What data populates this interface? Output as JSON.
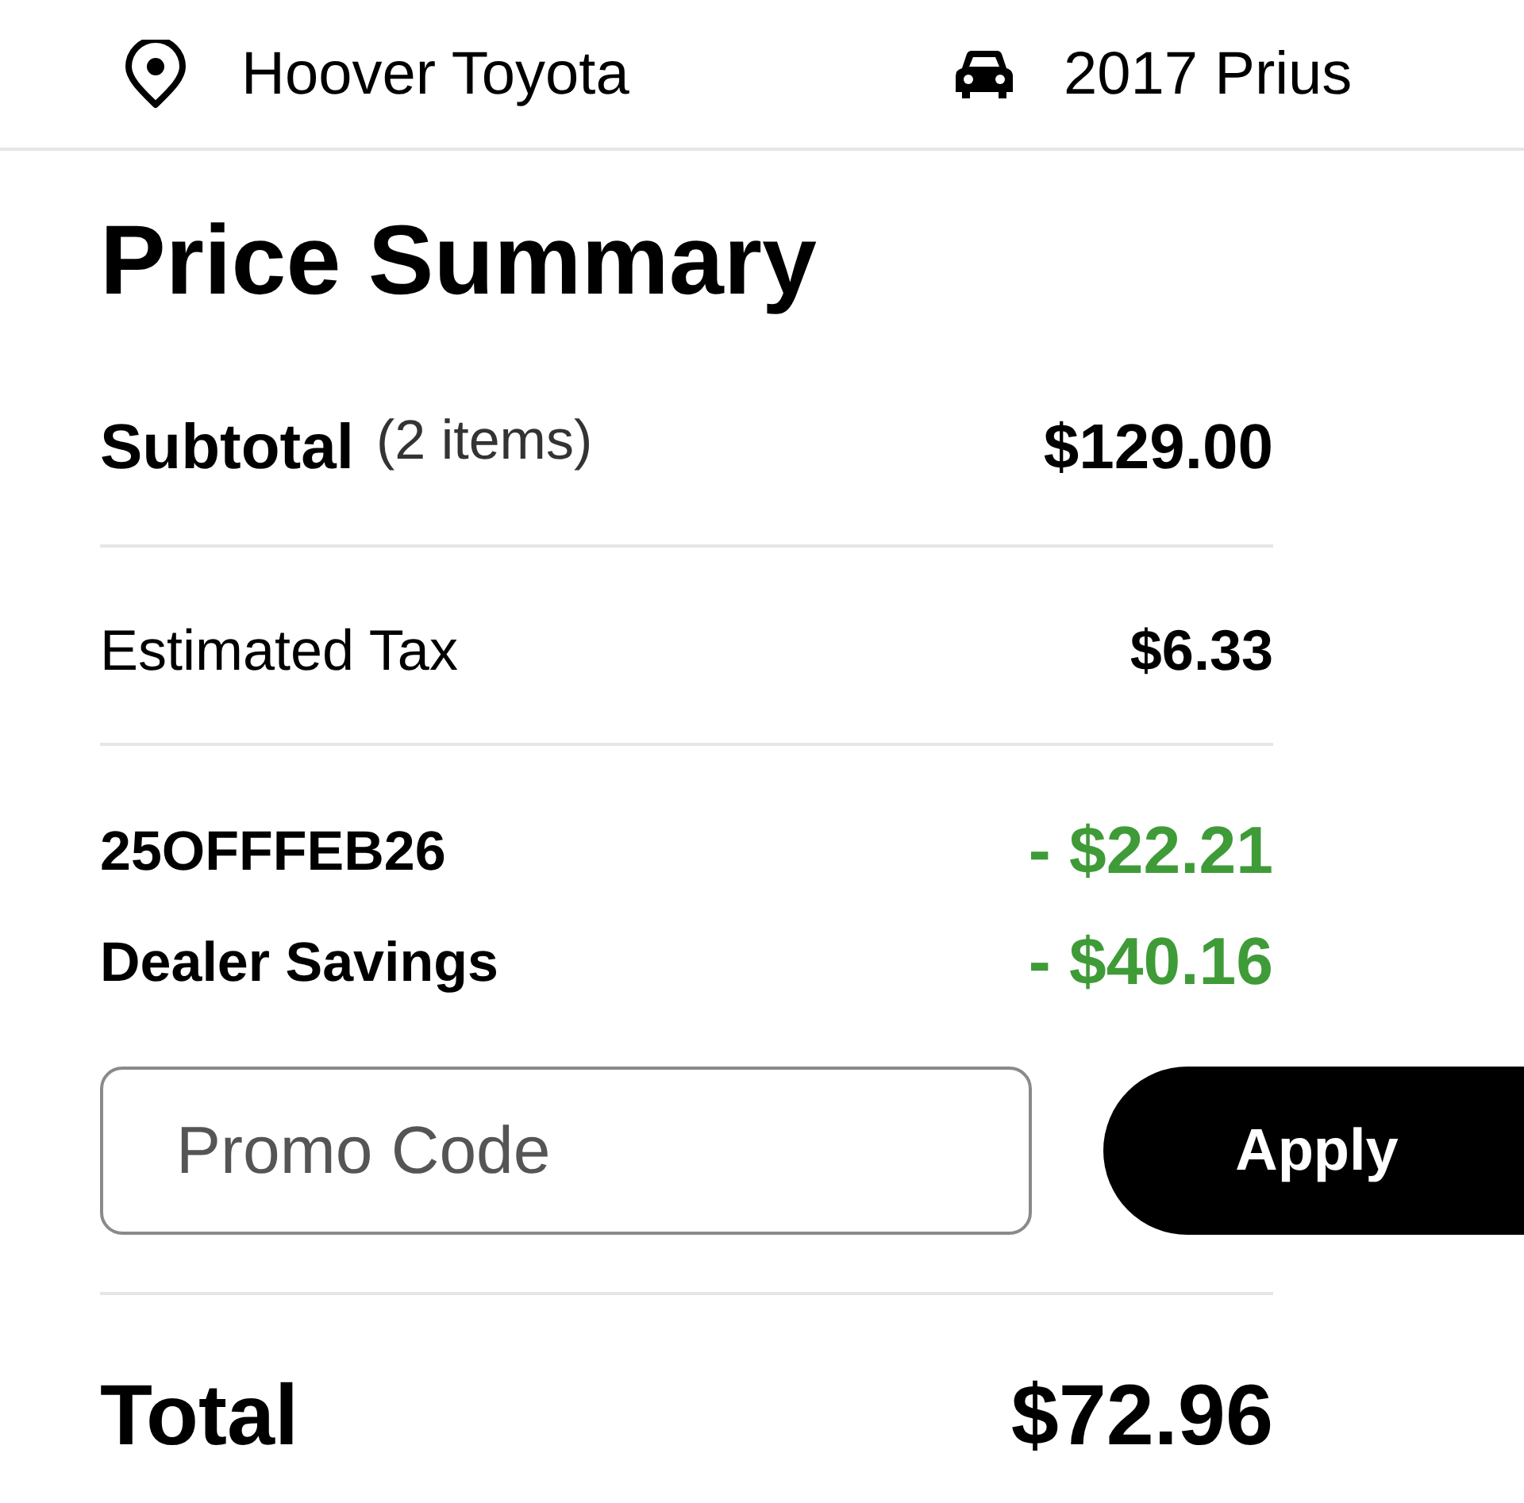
{
  "header": {
    "dealer": "Hoover Toyota",
    "vehicle": "2017 Prius"
  },
  "title": "Price Summary",
  "subtotal": {
    "label": "Subtotal",
    "count": "(2 items)",
    "amount": "$129.00"
  },
  "tax": {
    "label": "Estimated Tax",
    "amount": "$6.33"
  },
  "discounts": [
    {
      "label": "25OFFFEB26",
      "amount": "- $22.21"
    },
    {
      "label": "Dealer Savings",
      "amount": "- $40.16"
    }
  ],
  "promo": {
    "placeholder": "Promo Code",
    "button": "Apply"
  },
  "total": {
    "label": "Total",
    "amount": "$72.96"
  }
}
